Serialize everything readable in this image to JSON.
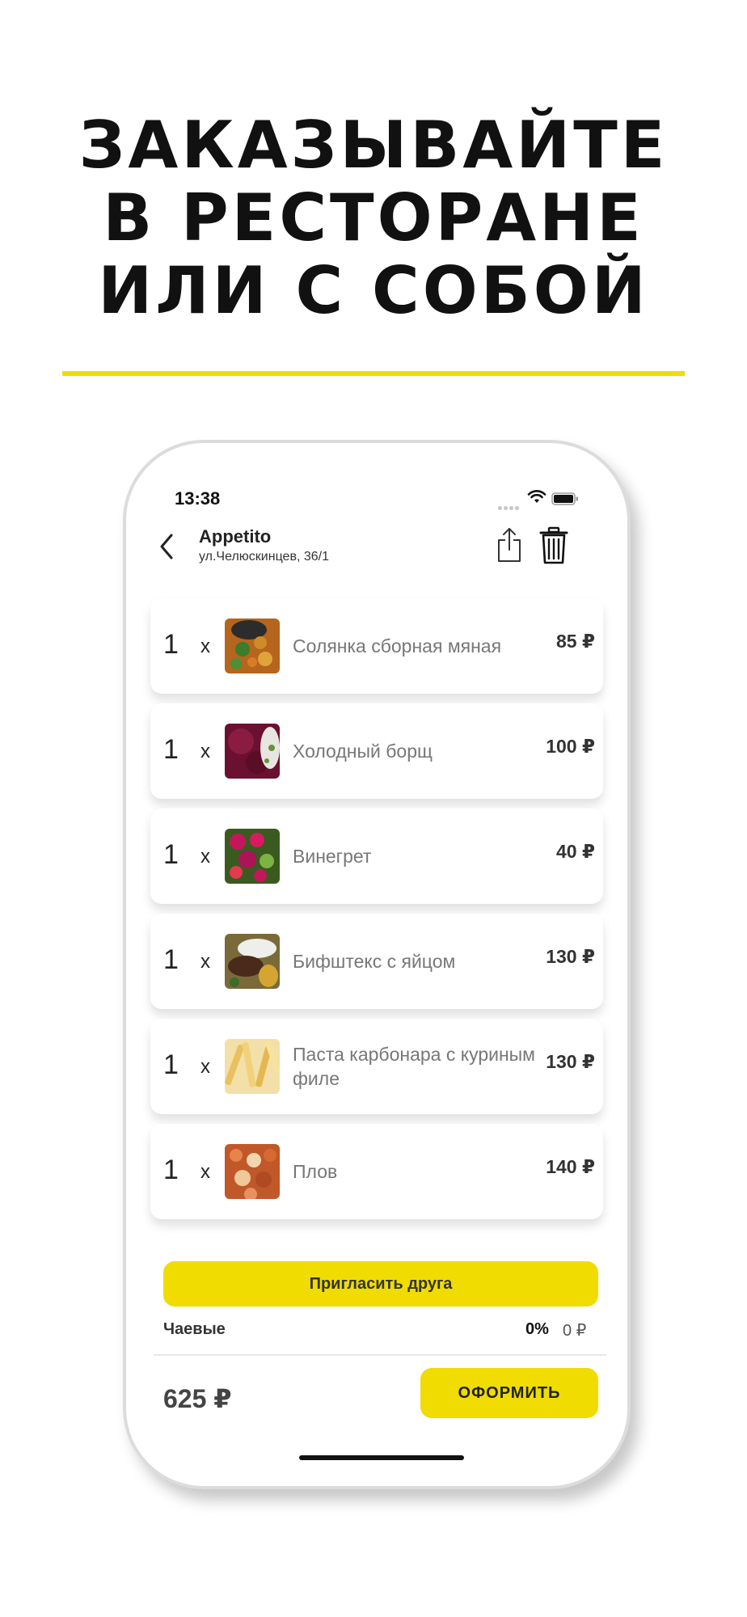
{
  "headline": {
    "line1": "ЗАКАЗЫВАЙТЕ",
    "line2": "В РЕСТОРАНЕ",
    "line3": "ИЛИ С СОБОЙ"
  },
  "colors": {
    "accent": "#f0dc00",
    "text": "#1a1a1a",
    "muted": "#777777"
  },
  "status_bar": {
    "time": "13:38",
    "icons": [
      "signal-icon",
      "wifi-icon",
      "battery-icon"
    ]
  },
  "header": {
    "venue_name": "Appetito",
    "venue_address": "ул.Челюскинцев, 36/1",
    "icons": [
      "back-icon",
      "share-icon",
      "trash-icon"
    ]
  },
  "order_items": [
    {
      "qty": "1",
      "times": "x",
      "name": "Солянка сборная мяная",
      "price": "85 ₽"
    },
    {
      "qty": "1",
      "times": "x",
      "name": "Холодный борщ",
      "price": "100 ₽"
    },
    {
      "qty": "1",
      "times": "x",
      "name": "Винегрет",
      "price": "40 ₽"
    },
    {
      "qty": "1",
      "times": "x",
      "name": "Бифштекс с яйцом",
      "price": "130 ₽"
    },
    {
      "qty": "1",
      "times": "x",
      "name": "Паста карбонара с куриным филе",
      "price": "130 ₽"
    },
    {
      "qty": "1",
      "times": "x",
      "name": "Плов",
      "price": "140 ₽"
    }
  ],
  "invite_button": "Пригласить друга",
  "tips": {
    "label": "Чаевые",
    "percent": "0%",
    "amount": "0 ₽"
  },
  "total": "625 ₽",
  "checkout_button": "ОФОРМИТЬ"
}
